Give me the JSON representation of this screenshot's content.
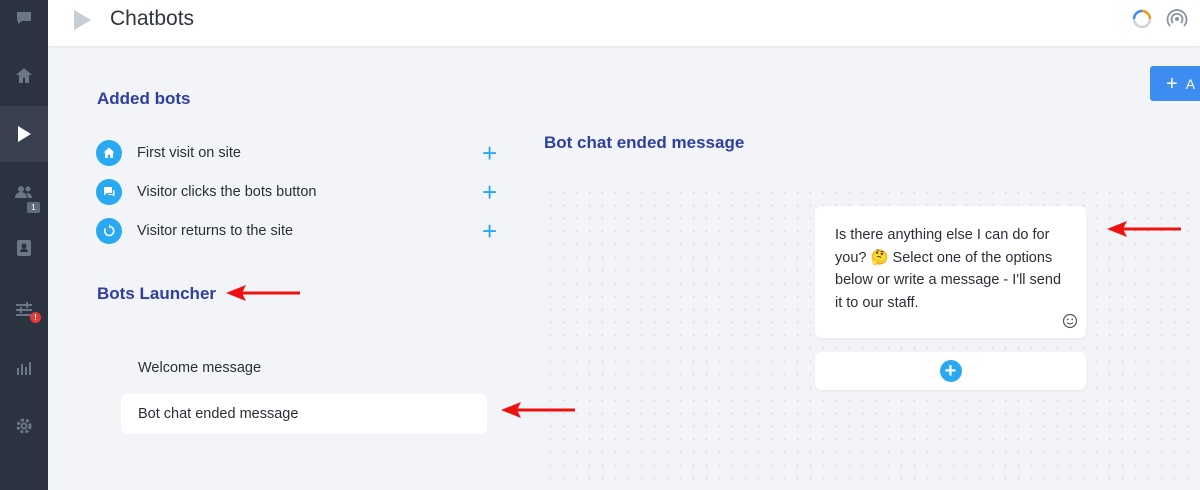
{
  "header": {
    "title": "Chatbots"
  },
  "sidebar": {
    "items": [
      {
        "icon": "chat-icon"
      },
      {
        "icon": "home-icon"
      },
      {
        "icon": "play-icon",
        "active": true
      },
      {
        "icon": "users-icon",
        "badge": "1"
      },
      {
        "icon": "contacts-icon"
      },
      {
        "icon": "settings-sliders-icon",
        "alert": "!"
      },
      {
        "icon": "bar-chart-icon"
      },
      {
        "icon": "gear-icon"
      }
    ]
  },
  "toolbar": {
    "add_label": "A"
  },
  "added_bots": {
    "title": "Added bots",
    "items": [
      {
        "label": "First visit on site",
        "icon": "home-icon"
      },
      {
        "label": "Visitor clicks the bots button",
        "icon": "chat-bubble-icon"
      },
      {
        "label": "Visitor returns to the site",
        "icon": "refresh-icon"
      }
    ]
  },
  "launcher": {
    "title": "Bots Launcher",
    "items": [
      {
        "label": "Welcome message",
        "selected": false
      },
      {
        "label": "Bot chat ended message",
        "selected": true
      }
    ]
  },
  "editor": {
    "title": "Bot chat ended message",
    "message": "Is there anything else I can do for you? 🤔 Select one of the options below or write a message - I'll send it to our staff."
  },
  "colors": {
    "accent": "#28a9f1",
    "heading": "#2e3f9e",
    "sidebar": "#2b3240",
    "arrow": "#ee1111",
    "button": "#3d8cf2"
  }
}
